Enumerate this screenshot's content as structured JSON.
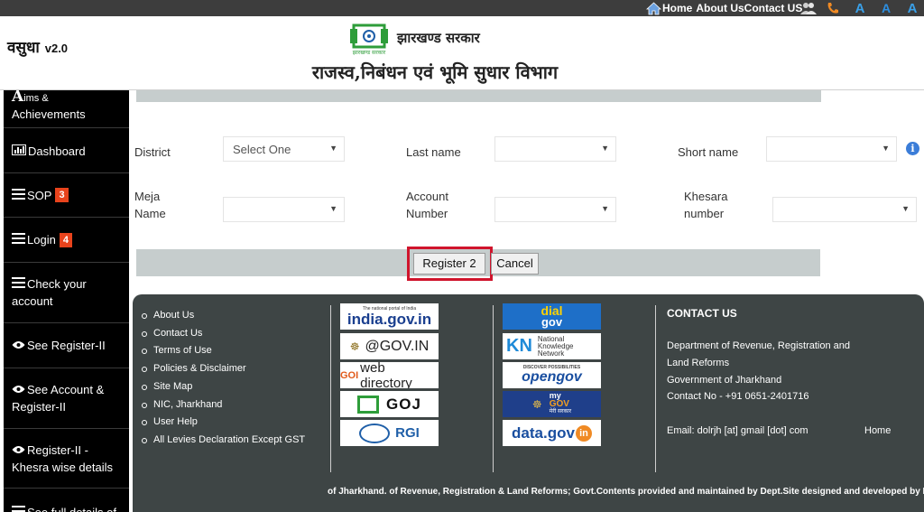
{
  "topbar": {
    "links": [
      "Home",
      "About Us",
      "Contact US"
    ],
    "accessibility": [
      "A",
      "A",
      "A"
    ]
  },
  "header": {
    "brand": "वसुधा",
    "version": "v2.0",
    "logo_caption": "झारखण्ड सरकार",
    "gov_name": "झारखण्ड सरकार",
    "dept_name": "राजस्व,निबंधन एवं भूमि सुधार  विभाग"
  },
  "sidebar": {
    "items": [
      {
        "label_big": "A",
        "label": "ims &",
        "label2": "Achievements",
        "icon": "aims-icon"
      },
      {
        "label": "Dashboard",
        "icon": "chart-icon"
      },
      {
        "label": "SOP",
        "badge": "3",
        "icon": "list-icon"
      },
      {
        "label": "Login",
        "badge": "4",
        "icon": "list-icon"
      },
      {
        "label": "Check your",
        "label2": "account",
        "icon": "list-icon"
      },
      {
        "label": "See Register-II",
        "icon": "eye-icon"
      },
      {
        "label": "See Account &",
        "label2": "Register-II",
        "icon": "eye-icon"
      },
      {
        "label": "Register-II -",
        "label2": "Khesra wise details",
        "icon": "eye-icon"
      },
      {
        "label": "See full details of",
        "icon": "list-icon"
      }
    ]
  },
  "form": {
    "district_label": "District",
    "district_value": "Select One",
    "last_name_label": "Last name",
    "last_name_value": "",
    "short_name_label": "Short name",
    "short_name_value": "",
    "meja_label_1": "Meja",
    "meja_label_2": "Name",
    "meja_value": "",
    "account_label_1": "Account",
    "account_label_2": "Number",
    "account_value": "",
    "khesara_label_1": "Khesara",
    "khesara_label_2": "number",
    "khesara_value": "",
    "register_button": "Register 2",
    "cancel_button": "Cancel"
  },
  "footer": {
    "links": [
      "About Us",
      "Contact Us",
      "Terms of Use",
      "Policies & Disclaimer",
      "Site Map",
      "NIC, Jharkhand",
      "User Help",
      "All Levies Declaration Except GST"
    ],
    "logos_left": [
      {
        "text": "india.gov.in",
        "sub": "The national portal of India"
      },
      {
        "text": "@GOV.IN"
      },
      {
        "text": "web directory",
        "prefix": "GOI"
      },
      {
        "text": "GOJ"
      },
      {
        "text": "RGI"
      }
    ],
    "logos_right": [
      {
        "text": "dial",
        "text2": "gov"
      },
      {
        "text": "National",
        "text2": "Knowledge",
        "text3": "Network",
        "prefix": "KN"
      },
      {
        "text": "opengov",
        "sub": "DISCOVER POSSIBILITIES"
      },
      {
        "text": "my",
        "text2": "GOV",
        "sub": "मेरी सरकार"
      },
      {
        "text": "data.gov",
        "suffix": "in"
      }
    ],
    "contact_title": "CONTACT US",
    "contact_lines": [
      "Department of Revenue, Registration and",
      "Land Reforms",
      "Government of Jharkhand",
      "Contact No - +91 0651-2401716"
    ],
    "email": "Email: dolrjh [at] gmail [dot] com",
    "home": "Home",
    "copyright": "of Jharkhand.  of Revenue, Registration & Land Reforms; Govt.Contents provided and maintained by Dept.Site designed and developed by NIC."
  },
  "colors": {
    "topbar": "#3d3d3d",
    "sidebar": "#000000",
    "badge": "#e8431c",
    "footer": "#3e4545",
    "highlight": "#d0142c",
    "strip": "#c6cdcd"
  }
}
